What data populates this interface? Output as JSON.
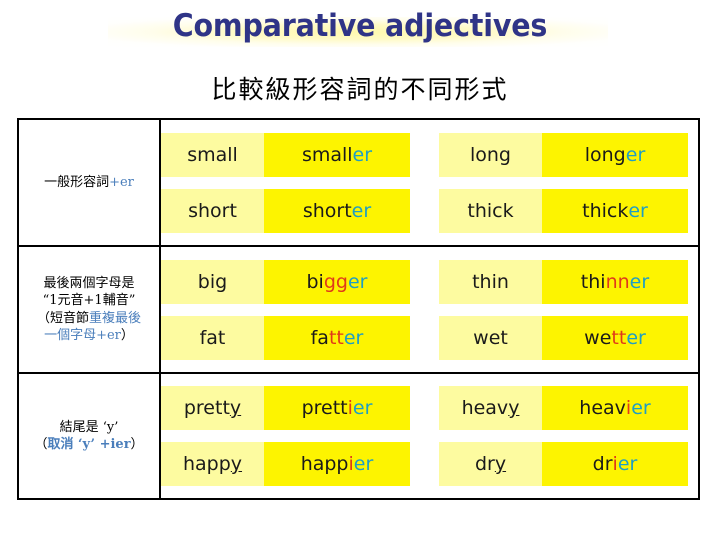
{
  "slide": {
    "title": "Comparative adjectives",
    "subtitle": "比較級形容詞的不同形式"
  },
  "colors": {
    "title_blue": "#2f3487",
    "glow_yellow": "#fff8aa",
    "base_cell_yellow": "#fdfba0",
    "comparative_cell_yellow": "#fdf400",
    "suffix_cyan": "#1f9ec4",
    "double_letter_red": "#e03a1a",
    "rule_accent_blue": "#4a7ebb",
    "border_black": "#000000"
  },
  "table": {
    "groups": [
      {
        "rule": {
          "lines": [
            [
              {
                "text": "一般形容詞",
                "style": "plain"
              },
              {
                "text": "+er",
                "style": "blue"
              }
            ]
          ]
        },
        "pairs": [
          {
            "base": [
              {
                "text": "small",
                "style": "plain"
              }
            ],
            "comparative": [
              {
                "text": "small",
                "style": "plain"
              },
              {
                "text": "er",
                "style": "cyan"
              }
            ]
          },
          {
            "base": [
              {
                "text": "long",
                "style": "plain"
              }
            ],
            "comparative": [
              {
                "text": "long",
                "style": "plain"
              },
              {
                "text": "er",
                "style": "cyan"
              }
            ]
          },
          {
            "base": [
              {
                "text": "short",
                "style": "plain"
              }
            ],
            "comparative": [
              {
                "text": "short",
                "style": "plain"
              },
              {
                "text": "er",
                "style": "cyan"
              }
            ]
          },
          {
            "base": [
              {
                "text": "thick",
                "style": "plain"
              }
            ],
            "comparative": [
              {
                "text": "thick",
                "style": "plain"
              },
              {
                "text": "er",
                "style": "cyan"
              }
            ]
          }
        ]
      },
      {
        "rule": {
          "lines": [
            [
              {
                "text": "最後兩個字母是",
                "style": "plain"
              }
            ],
            [
              {
                "text": "“1元音+1輔音”",
                "style": "plain"
              }
            ],
            [
              {
                "text": "（短音節",
                "style": "plain"
              },
              {
                "text": "重複最後",
                "style": "blue"
              }
            ],
            [
              {
                "text": "一個字母+er",
                "style": "blue"
              },
              {
                "text": "）",
                "style": "plain"
              }
            ]
          ]
        },
        "pairs": [
          {
            "base": [
              {
                "text": "big",
                "style": "plain"
              }
            ],
            "comparative": [
              {
                "text": "bi",
                "style": "plain"
              },
              {
                "text": "gg",
                "style": "red"
              },
              {
                "text": "er",
                "style": "cyan"
              }
            ]
          },
          {
            "base": [
              {
                "text": "thin",
                "style": "plain"
              }
            ],
            "comparative": [
              {
                "text": "thi",
                "style": "plain"
              },
              {
                "text": "nn",
                "style": "red"
              },
              {
                "text": "er",
                "style": "cyan"
              }
            ]
          },
          {
            "base": [
              {
                "text": "fat",
                "style": "plain"
              }
            ],
            "comparative": [
              {
                "text": "fa",
                "style": "plain"
              },
              {
                "text": "tt",
                "style": "red"
              },
              {
                "text": "er",
                "style": "cyan"
              }
            ]
          },
          {
            "base": [
              {
                "text": "wet",
                "style": "plain"
              }
            ],
            "comparative": [
              {
                "text": "we",
                "style": "plain"
              },
              {
                "text": "tt",
                "style": "red"
              },
              {
                "text": "er",
                "style": "cyan"
              }
            ]
          }
        ]
      },
      {
        "rule": {
          "lines": [
            [
              {
                "text": "結尾是 ‘y’",
                "style": "plain"
              }
            ],
            [
              {
                "text": "（",
                "style": "plain"
              },
              {
                "text": "取消 ‘y’ +ier",
                "style": "blue-bold"
              },
              {
                "text": "）",
                "style": "plain"
              }
            ]
          ]
        },
        "pairs": [
          {
            "base": [
              {
                "text": "prett",
                "style": "plain"
              },
              {
                "text": "y",
                "style": "underline"
              }
            ],
            "comparative": [
              {
                "text": "prett",
                "style": "plain"
              },
              {
                "text": "i",
                "style": "red"
              },
              {
                "text": "er",
                "style": "cyan"
              }
            ]
          },
          {
            "base": [
              {
                "text": "heav",
                "style": "plain"
              },
              {
                "text": "y",
                "style": "underline"
              }
            ],
            "comparative": [
              {
                "text": "heav",
                "style": "plain"
              },
              {
                "text": "i",
                "style": "red"
              },
              {
                "text": "er",
                "style": "cyan"
              }
            ]
          },
          {
            "base": [
              {
                "text": "happ",
                "style": "plain"
              },
              {
                "text": "y",
                "style": "underline"
              }
            ],
            "comparative": [
              {
                "text": "happ",
                "style": "plain"
              },
              {
                "text": "i",
                "style": "red"
              },
              {
                "text": "er",
                "style": "cyan"
              }
            ]
          },
          {
            "base": [
              {
                "text": "dr",
                "style": "plain"
              },
              {
                "text": "y",
                "style": "underline"
              }
            ],
            "comparative": [
              {
                "text": "dr",
                "style": "plain"
              },
              {
                "text": "i",
                "style": "red"
              },
              {
                "text": "er",
                "style": "cyan"
              }
            ]
          }
        ]
      }
    ]
  }
}
